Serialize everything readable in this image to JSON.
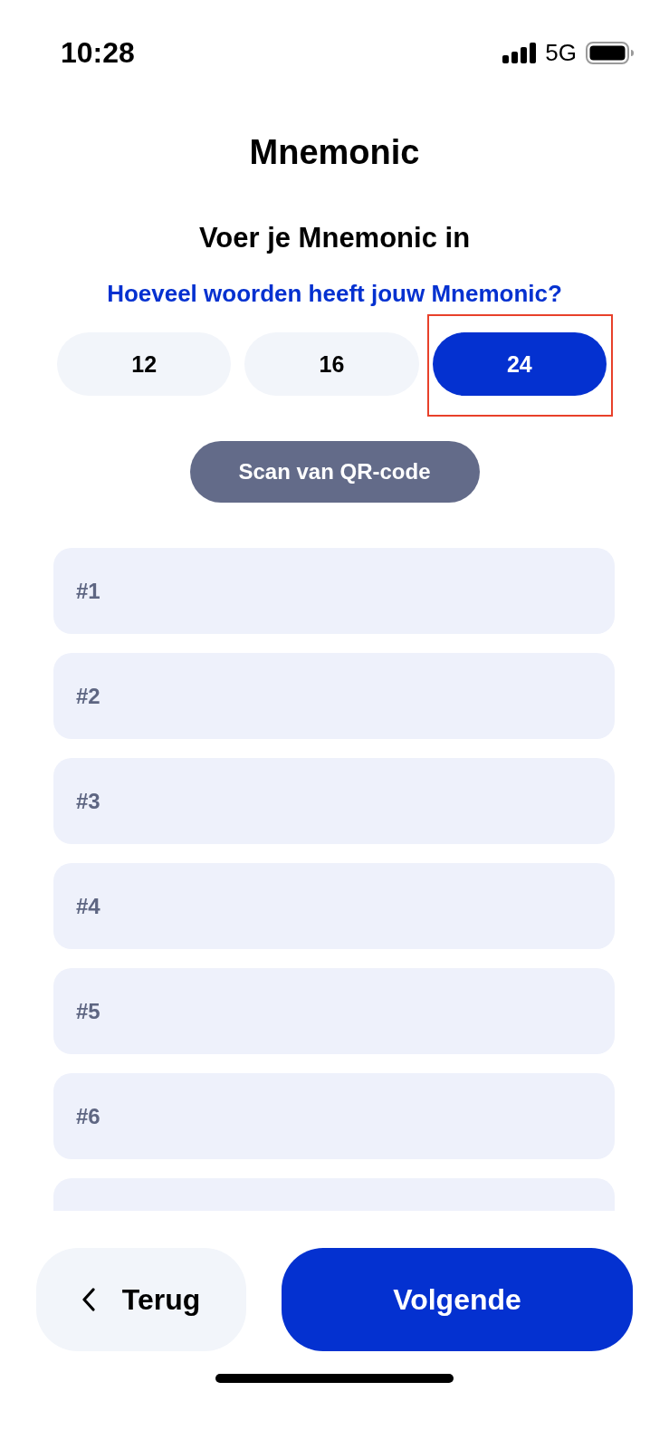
{
  "status_bar": {
    "time": "10:28",
    "network": "5G"
  },
  "title": "Mnemonic",
  "subtitle": "Voer je Mnemonic in",
  "question": "Hoeveel woorden heeft jouw Mnemonic?",
  "word_count_options": [
    {
      "label": "12",
      "selected": false,
      "highlighted": false
    },
    {
      "label": "16",
      "selected": false,
      "highlighted": false
    },
    {
      "label": "24",
      "selected": true,
      "highlighted": true
    }
  ],
  "scan_button": {
    "label": "Scan van QR-code"
  },
  "word_fields": [
    {
      "kind": "full",
      "placeholder": "#1"
    },
    {
      "kind": "full",
      "placeholder": "#2"
    },
    {
      "kind": "full",
      "placeholder": "#3"
    },
    {
      "kind": "full",
      "placeholder": "#4"
    },
    {
      "kind": "full",
      "placeholder": "#5"
    },
    {
      "kind": "full",
      "placeholder": "#6"
    },
    {
      "kind": "cut"
    }
  ],
  "footer_buttons": [
    {
      "kind": "back",
      "label": "Terug"
    },
    {
      "kind": "primary",
      "label": "Volgende"
    }
  ]
}
